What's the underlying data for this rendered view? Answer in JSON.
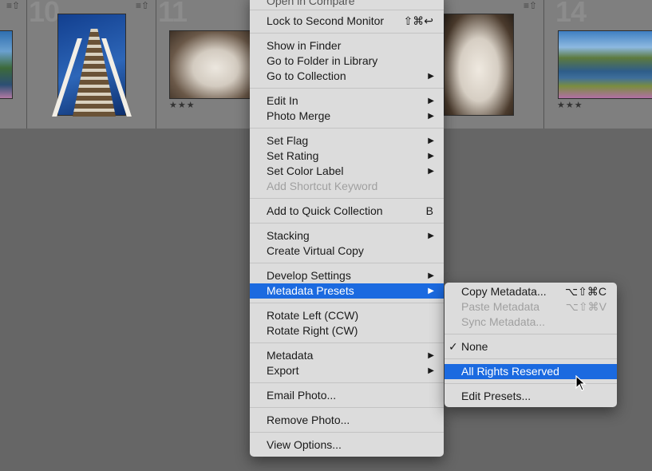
{
  "filmstrip": {
    "cells": [
      {
        "number": "10",
        "stars": ""
      },
      {
        "number": "11",
        "stars": "★★★"
      },
      {
        "number": "14",
        "stars": "★★★"
      }
    ],
    "badge_icon": "metadata-badge-icon"
  },
  "context_menu": {
    "top_partial": "Open in Compare",
    "lock_second_monitor": {
      "label": "Lock to Second Monitor",
      "shortcut": "⇧⌘↩"
    },
    "show_in_finder": "Show in Finder",
    "go_to_folder": "Go to Folder in Library",
    "go_to_collection": "Go to Collection",
    "edit_in": "Edit In",
    "photo_merge": "Photo Merge",
    "set_flag": "Set Flag",
    "set_rating": "Set Rating",
    "set_color_label": "Set Color Label",
    "add_shortcut_keyword": "Add Shortcut Keyword",
    "add_quick_collection": {
      "label": "Add to Quick Collection",
      "shortcut": "B"
    },
    "stacking": "Stacking",
    "create_virtual_copy": "Create Virtual Copy",
    "develop_settings": "Develop Settings",
    "metadata_presets": "Metadata Presets",
    "rotate_left": "Rotate Left (CCW)",
    "rotate_right": "Rotate Right (CW)",
    "metadata": "Metadata",
    "export": "Export",
    "email_photo": "Email Photo...",
    "remove_photo": "Remove Photo...",
    "view_options": "View Options...",
    "submenu_arrow": "▶"
  },
  "submenu": {
    "copy_metadata": {
      "label": "Copy Metadata...",
      "shortcut": "⌥⇧⌘C"
    },
    "paste_metadata": {
      "label": "Paste Metadata",
      "shortcut": "⌥⇧⌘V"
    },
    "sync_metadata": "Sync Metadata...",
    "none": {
      "label": "None",
      "checked": "✓"
    },
    "all_rights_reserved": "All Rights Reserved",
    "edit_presets": "Edit Presets..."
  },
  "colors": {
    "highlight": "#1b6ae0",
    "menu_bg": "#dcdcdc",
    "background": "#666666"
  }
}
